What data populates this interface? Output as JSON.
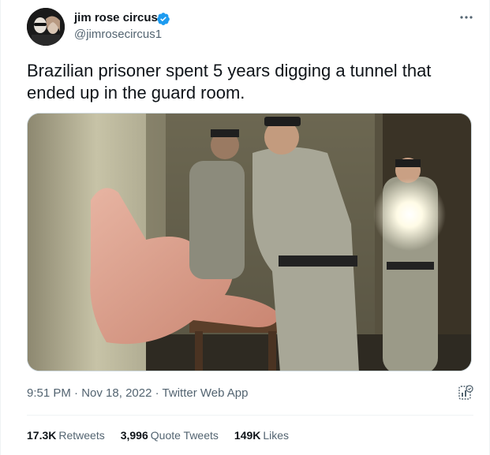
{
  "author": {
    "display_name": "jim rose circus",
    "handle": "@jimrosecircus1",
    "verified_color": "#1d9bf0"
  },
  "tweet": {
    "text_line1": "Brazilian prisoner spent 5 years digging a tunnel that",
    "text_line2": "ended up in the guard room."
  },
  "meta": {
    "time": "9:51 PM",
    "sep1": "·",
    "date": "Nov 18, 2022",
    "sep2": "·",
    "source": "Twitter Web App"
  },
  "stats": {
    "retweets_count": "17.3K",
    "retweets_label": "Retweets",
    "quotes_count": "3,996",
    "quotes_label": "Quote Tweets",
    "likes_count": "149K",
    "likes_label": "Likes"
  },
  "icons": {
    "verified": "verified-badge-icon",
    "more": "more-dots-icon",
    "analytics": "analytics-icon"
  }
}
